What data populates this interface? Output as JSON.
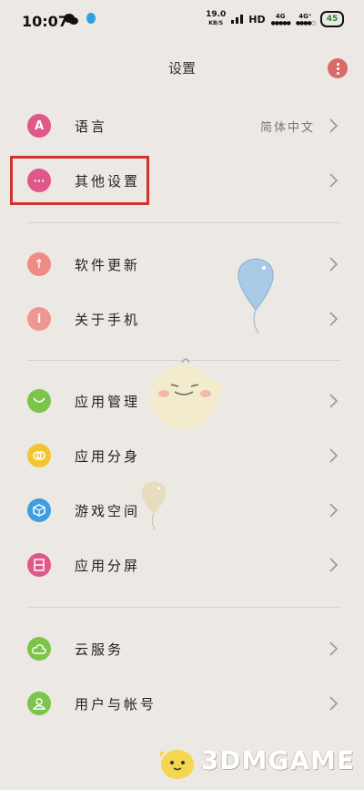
{
  "status": {
    "time": "10:07",
    "net_speed_value": "19.0",
    "net_speed_unit": "KB/S",
    "hd": "HD",
    "sim1": "4G",
    "sim2": "4G⁺",
    "battery": "45"
  },
  "header": {
    "title": "设置"
  },
  "items": [
    {
      "label": "语言",
      "value": "简体中文",
      "icon": "letter-a-icon",
      "color": "#e0578a",
      "glyph": "A"
    },
    {
      "label": "其他设置",
      "icon": "more-dots-icon",
      "color": "#e0578a",
      "glyph": "···"
    },
    {
      "label": "软件更新",
      "icon": "arrow-up-icon",
      "color": "#ef8a85",
      "glyph": "↑"
    },
    {
      "label": "关于手机",
      "icon": "info-icon",
      "color": "#f09590",
      "glyph": "i"
    },
    {
      "label": "应用管理",
      "icon": "app-manage-icon",
      "color": "#7cc44a",
      "glyph": ""
    },
    {
      "label": "应用分身",
      "icon": "app-clone-icon",
      "color": "#f2c530",
      "glyph": "∞"
    },
    {
      "label": "游戏空间",
      "icon": "game-space-icon",
      "color": "#3e9ee0",
      "glyph": "⬡"
    },
    {
      "label": "应用分屏",
      "icon": "split-screen-icon",
      "color": "#e0578a",
      "glyph": "▤"
    },
    {
      "label": "云服务",
      "icon": "cloud-icon",
      "color": "#7cc44a",
      "glyph": "☁"
    },
    {
      "label": "用户与帐号",
      "icon": "user-icon",
      "color": "#7cc44a",
      "glyph": "☺"
    }
  ],
  "watermark": {
    "text": "3DMGAME"
  },
  "colors": {
    "background": "#ece8e4",
    "highlight": "#d2332d",
    "more_button": "#d96a6a"
  }
}
